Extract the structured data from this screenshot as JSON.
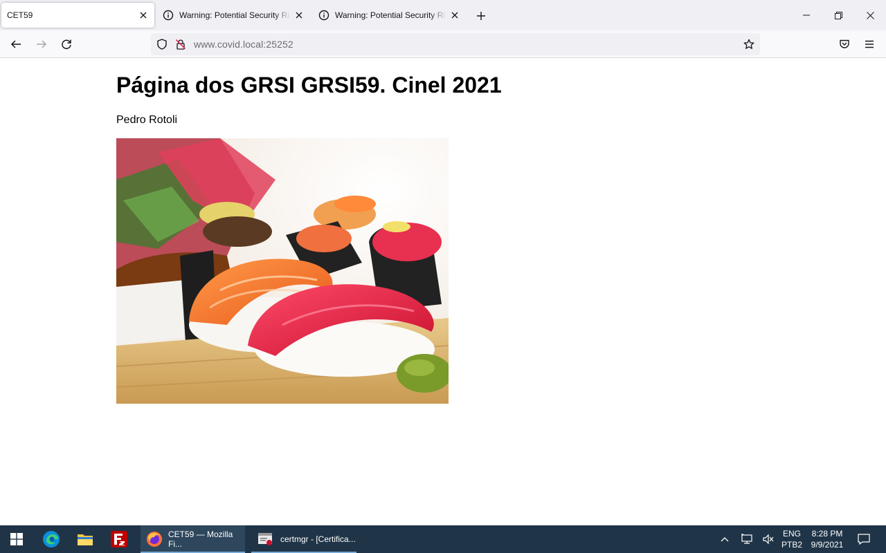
{
  "browser": {
    "tabs": [
      {
        "label": "CET59",
        "active": true
      },
      {
        "label": "Warning: Potential Security Risk Ahead",
        "active": false
      },
      {
        "label": "Warning: Potential Security Risk Ahead",
        "active": false
      }
    ],
    "url": {
      "host": "www.covid.local",
      "port": ":25252"
    }
  },
  "page": {
    "title": "Página dos GRSI GRSI59. Cinel 2021",
    "author": "Pedro Rotoli"
  },
  "taskbar": {
    "apps": [
      {
        "label": "CET59 — Mozilla Fi..."
      },
      {
        "label": "certmgr - [Certifica..."
      }
    ],
    "tray": {
      "lang1": "ENG",
      "lang2": "PTB2",
      "time": "8:28 PM",
      "date": "9/9/2021"
    }
  },
  "colors": {
    "taskbar": "#1f3447",
    "tab_strip": "#f0f0f4",
    "accent_underline": "#78a9d8"
  }
}
